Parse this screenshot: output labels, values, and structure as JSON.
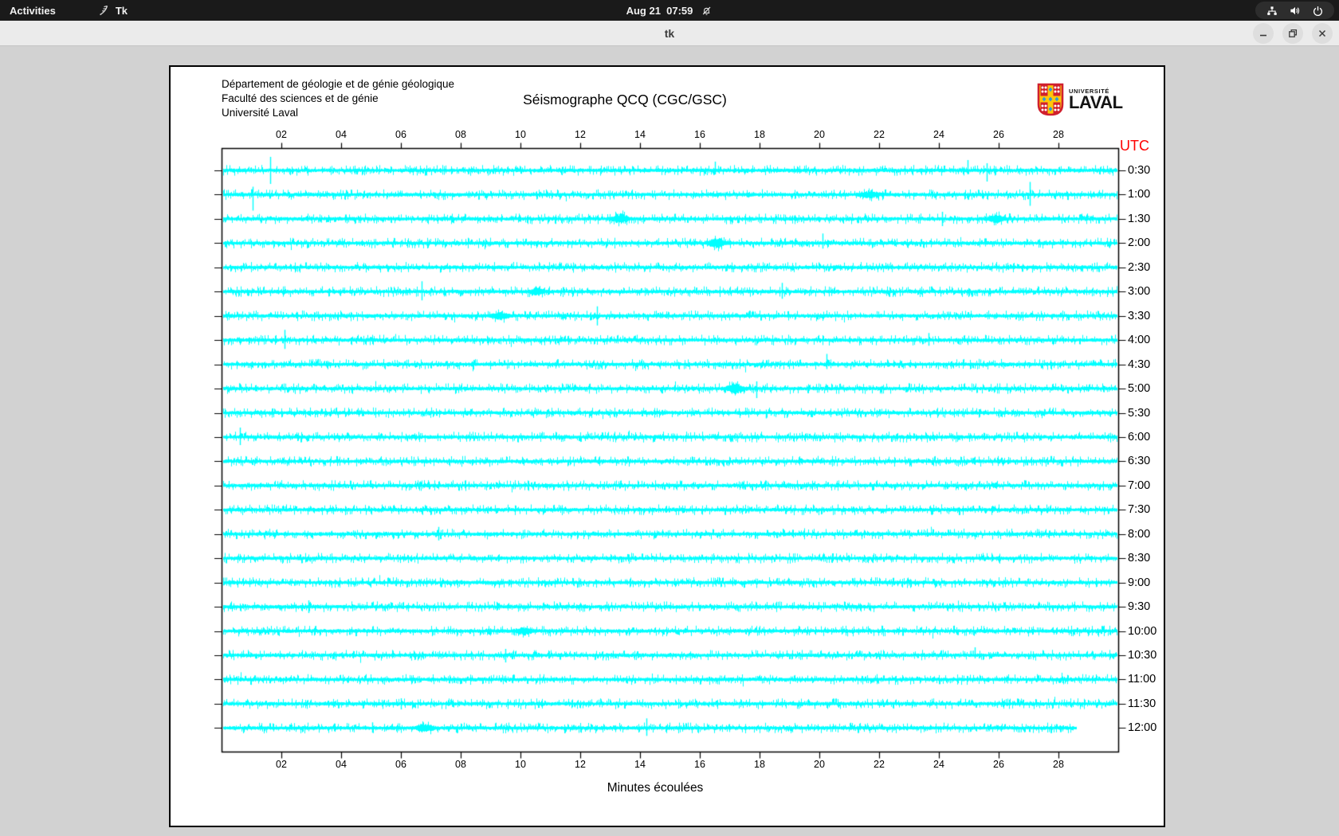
{
  "topbar": {
    "activities_label": "Activities",
    "app_name": "Tk",
    "clock": "Aug 21  07:59"
  },
  "titlebar": {
    "title": "tk"
  },
  "seismograph": {
    "header_lines": [
      "Département de géologie et de génie géologique",
      "Faculté des sciences et de génie",
      "Université Laval"
    ],
    "title": "Séismographe QCQ (CGC/GSC)",
    "logo": {
      "line1": "UNIVERSITÉ",
      "line2": "LAVAL"
    },
    "utc_label": "UTC",
    "x_axis_label": "Minutes écoulées",
    "x_ticks": [
      "02",
      "04",
      "06",
      "08",
      "10",
      "12",
      "14",
      "16",
      "18",
      "20",
      "22",
      "24",
      "26",
      "28"
    ],
    "x_range_minutes": [
      0,
      30
    ],
    "trace_labels": [
      "0:30",
      "1:00",
      "1:30",
      "2:00",
      "2:30",
      "3:00",
      "3:30",
      "4:00",
      "4:30",
      "5:00",
      "5:30",
      "6:00",
      "6:30",
      "7:00",
      "7:30",
      "8:00",
      "8:30",
      "9:00",
      "9:30",
      "10:00",
      "10:30",
      "11:00",
      "11:30",
      "12:00"
    ],
    "last_trace_end_minute": 28.6,
    "colors": {
      "trace": "#00ffff",
      "utc": "#ff0000",
      "frame": "#000000"
    },
    "events": {
      "spikes": [
        [
          0,
          1.62,
          17,
          17
        ],
        [
          0,
          16.5,
          11,
          5
        ],
        [
          0,
          24.95,
          13,
          5
        ],
        [
          0,
          25.6,
          9,
          14
        ],
        [
          1,
          1.05,
          10,
          20
        ],
        [
          1,
          27.05,
          16,
          14
        ],
        [
          2,
          24.1,
          9,
          9
        ],
        [
          3,
          20.1,
          12,
          7
        ],
        [
          5,
          6.7,
          13,
          11
        ],
        [
          5,
          18.75,
          11,
          9
        ],
        [
          6,
          12.55,
          12,
          12
        ],
        [
          7,
          2.1,
          13,
          11
        ],
        [
          7,
          23.65,
          9,
          7
        ],
        [
          8,
          20.25,
          13,
          6
        ],
        [
          9,
          17.9,
          9,
          12
        ],
        [
          10,
          18.2,
          4,
          7
        ],
        [
          11,
          0.62,
          12,
          10
        ],
        [
          15,
          7.25,
          9,
          8
        ],
        [
          18,
          2.9,
          8,
          8
        ],
        [
          20,
          9.5,
          8,
          9
        ],
        [
          20,
          25.2,
          10,
          4
        ],
        [
          22,
          6.0,
          7,
          7
        ],
        [
          23,
          5.05,
          7,
          6
        ],
        [
          23,
          14.2,
          12,
          10
        ]
      ],
      "blobs": [
        [
          1,
          21.7,
          0.5,
          4
        ],
        [
          2,
          13.35,
          0.45,
          5
        ],
        [
          2,
          25.9,
          0.5,
          4
        ],
        [
          3,
          16.55,
          0.5,
          5
        ],
        [
          5,
          10.55,
          0.4,
          4
        ],
        [
          6,
          9.3,
          0.5,
          4
        ],
        [
          9,
          17.2,
          0.5,
          5
        ],
        [
          19,
          10.1,
          0.5,
          4
        ],
        [
          23,
          6.8,
          0.5,
          4
        ]
      ]
    }
  }
}
